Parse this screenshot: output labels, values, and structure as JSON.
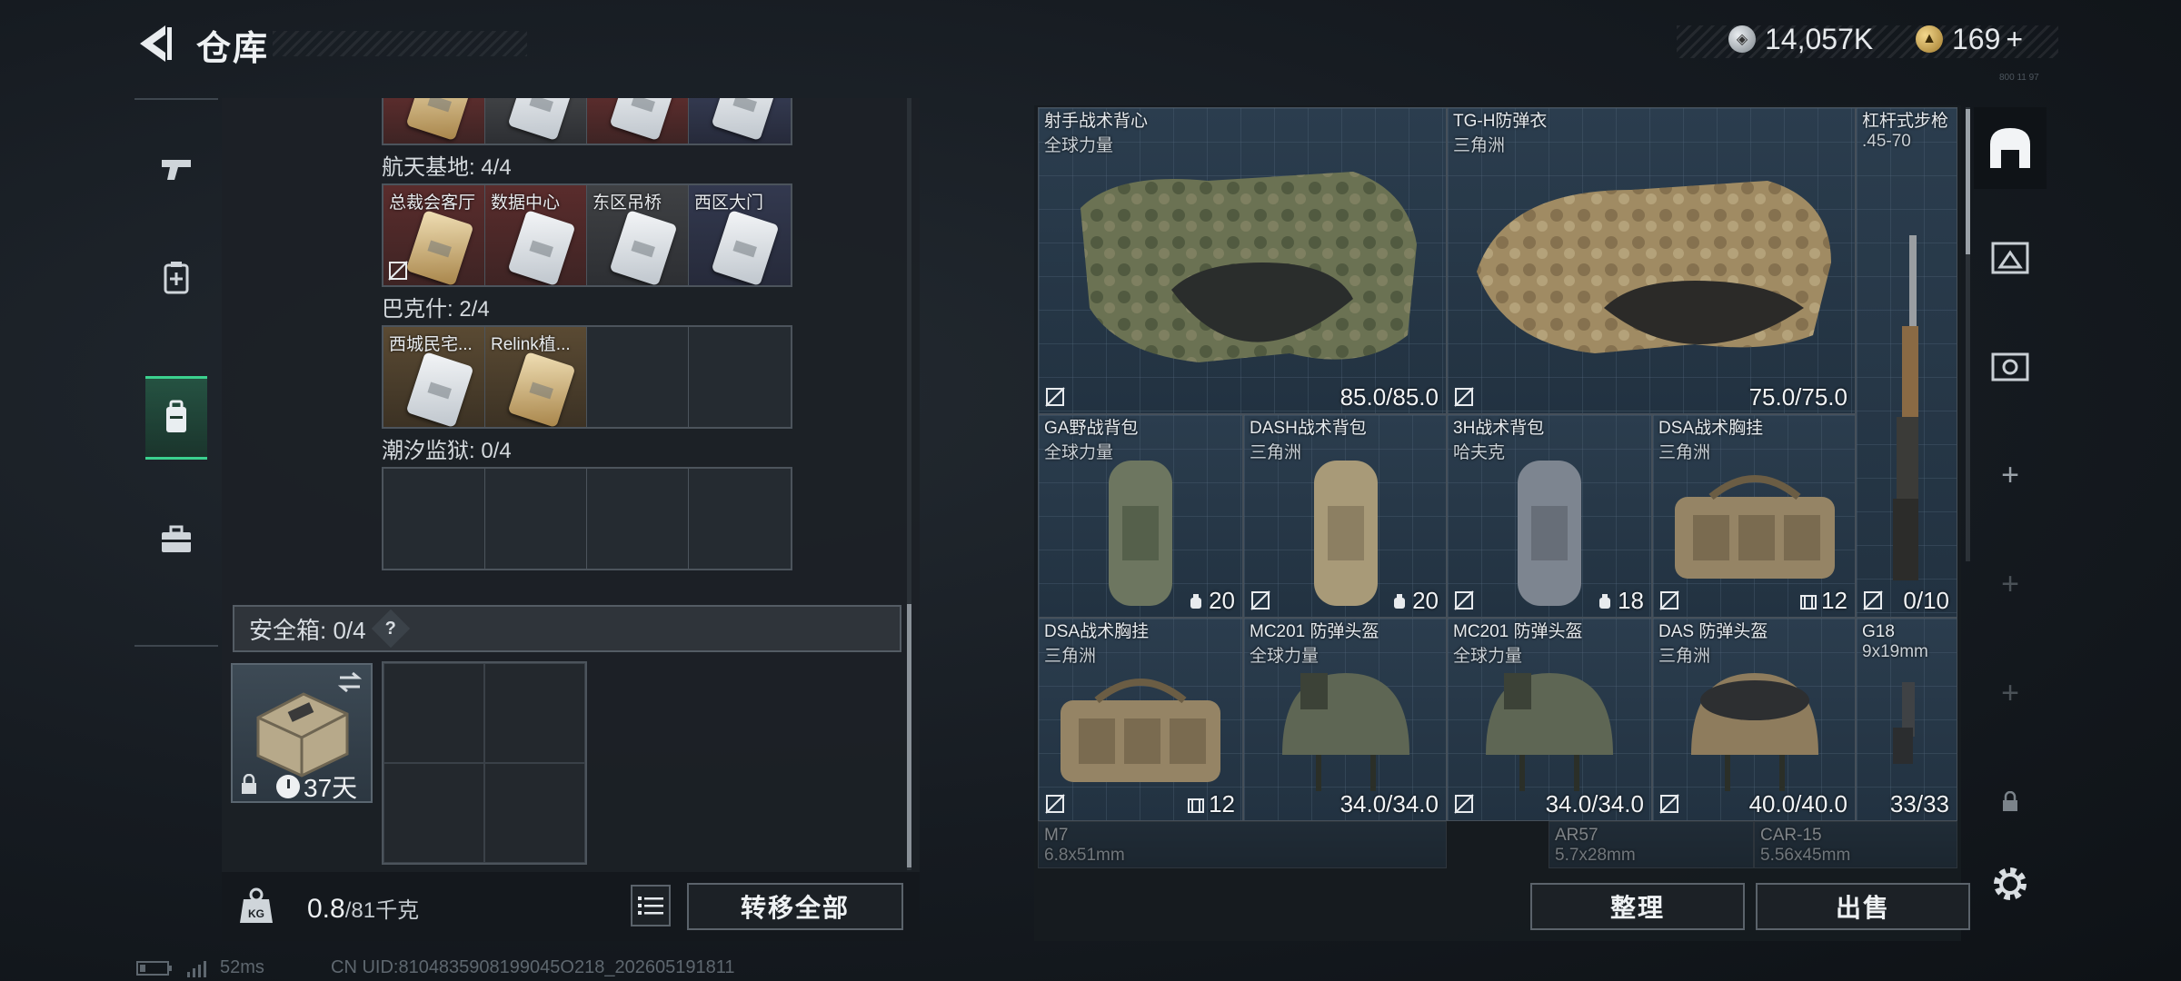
{
  "header": {
    "title": "仓库",
    "currency_silver": "14,057K",
    "currency_gold": "169",
    "plus": "+",
    "tiny_code": "800 11 97"
  },
  "left_nav": [
    "pistol-icon",
    "medkit-icon",
    "backpack-icon",
    "toolbox-icon"
  ],
  "keycards": {
    "groups": [
      {
        "label": "航天基地: 4/4",
        "slots": [
          {
            "name": "总裁会客厅",
            "style": "red"
          },
          {
            "name": "数据中心",
            "style": "red"
          },
          {
            "name": "东区吊桥",
            "style": "gray"
          },
          {
            "name": "西区大门",
            "style": "blue"
          }
        ]
      },
      {
        "label": "巴克什: 2/4",
        "slots": [
          {
            "name": "西城民宅...",
            "style": "gold"
          },
          {
            "name": "Relink植...",
            "style": "gold"
          },
          {
            "name": "",
            "style": "empty"
          },
          {
            "name": "",
            "style": "empty"
          }
        ]
      },
      {
        "label": "潮汐监狱: 0/4"
      }
    ]
  },
  "safe": {
    "header": "安全箱: 0/4",
    "help": "?",
    "timer": "37天"
  },
  "footer_left": {
    "weight_value": "0.8",
    "weight_max": "/81千克",
    "kg_label": "KG",
    "transfer_all": "转移全部"
  },
  "items": [
    {
      "name": "射手战术背心",
      "sub": "全球力量",
      "value": "85.0/85.0"
    },
    {
      "name": "TG-H防弹衣",
      "sub": "三角洲",
      "value": "75.0/75.0"
    },
    {
      "name": "杠杆式步枪",
      "sub": ".45-70",
      "value": "0/10"
    },
    {
      "name": "GA野战背包",
      "sub": "全球力量",
      "value": "20"
    },
    {
      "name": "DASH战术背包",
      "sub": "三角洲",
      "value": "20"
    },
    {
      "name": "3H战术背包",
      "sub": "哈夫克",
      "value": "18"
    },
    {
      "name": "DSA战术胸挂",
      "sub": "三角洲",
      "value": "12"
    },
    {
      "name": "DSA战术胸挂",
      "sub": "三角洲",
      "value": "12"
    },
    {
      "name": "MC201 防弹头盔",
      "sub": "全球力量",
      "value": "34.0/34.0"
    },
    {
      "name": "MC201 防弹头盔",
      "sub": "全球力量",
      "value": "34.0/34.0"
    },
    {
      "name": "DAS 防弹头盔",
      "sub": "三角洲",
      "value": "40.0/40.0"
    },
    {
      "name": "G18",
      "sub": "9x19mm",
      "value": "33/33"
    },
    {
      "name": "M7",
      "sub": "6.8x51mm"
    },
    {
      "name": "AR57",
      "sub": "5.7x28mm"
    },
    {
      "name": "CAR-15",
      "sub": "5.56x45mm"
    }
  ],
  "footer_right": {
    "sort": "整理",
    "sell": "出售"
  },
  "status": {
    "ping": "52ms",
    "uid": "CN UID:8104835908199045O218_202605191811"
  },
  "colors": {
    "accent_green": "#3bd18f",
    "item_bg": "#2b3d4e"
  }
}
